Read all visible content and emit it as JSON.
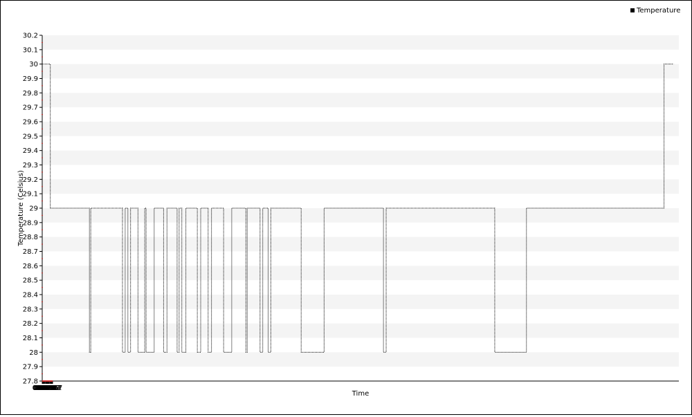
{
  "chart_data": {
    "type": "line",
    "step": true,
    "xlabel": "Time",
    "ylabel": "Temperature (Celsius)",
    "legend": {
      "position": "top-right"
    },
    "grid": "alternating horizontal bands",
    "colors": {
      "series": "#000000",
      "axis": "#000000",
      "tick_mark": "#d03030",
      "band": "#f4f4f4"
    },
    "x_ticks": [
      "00:00",
      "00:05",
      "00:10",
      "00:15",
      "00:20",
      "00:26",
      "00:31",
      "00:36",
      "00:41",
      "00:46",
      "00:51",
      "00:57",
      "01:02",
      "01:07",
      "01:12",
      "01:17"
    ],
    "xlim": [
      "00:00",
      "01:18:40"
    ],
    "ylim": [
      27.8,
      30.2
    ],
    "y_ticks": [
      "27.8",
      "27.9",
      "28",
      "28.1",
      "28.2",
      "28.3",
      "28.4",
      "28.5",
      "28.6",
      "28.7",
      "28.8",
      "28.9",
      "29",
      "29.1",
      "29.2",
      "29.3",
      "29.4",
      "29.5",
      "29.6",
      "29.7",
      "29.8",
      "29.9",
      "30",
      "30.1",
      "30.2"
    ],
    "series": [
      {
        "name": "Temperature",
        "points": [
          [
            "00:00:00",
            30
          ],
          [
            "00:01:00",
            29
          ],
          [
            "00:05:50",
            28
          ],
          [
            "00:06:00",
            29
          ],
          [
            "00:09:55",
            28
          ],
          [
            "00:10:15",
            29
          ],
          [
            "00:10:35",
            28
          ],
          [
            "00:10:55",
            29
          ],
          [
            "00:11:50",
            28
          ],
          [
            "00:12:40",
            29
          ],
          [
            "00:12:50",
            28
          ],
          [
            "00:13:50",
            29
          ],
          [
            "00:15:00",
            28
          ],
          [
            "00:15:25",
            29
          ],
          [
            "00:16:40",
            28
          ],
          [
            "00:16:55",
            29
          ],
          [
            "00:17:15",
            28
          ],
          [
            "00:17:45",
            29
          ],
          [
            "00:19:10",
            28
          ],
          [
            "00:19:35",
            29
          ],
          [
            "00:20:30",
            28
          ],
          [
            "00:20:55",
            29
          ],
          [
            "00:22:25",
            28
          ],
          [
            "00:23:25",
            29
          ],
          [
            "00:25:10",
            28
          ],
          [
            "00:25:20",
            29
          ],
          [
            "00:26:55",
            28
          ],
          [
            "00:27:15",
            29
          ],
          [
            "00:27:55",
            28
          ],
          [
            "00:28:15",
            29
          ],
          [
            "00:32:00",
            28
          ],
          [
            "00:34:50",
            29
          ],
          [
            "00:42:10",
            28
          ],
          [
            "00:42:30",
            29
          ],
          [
            "00:55:55",
            28
          ],
          [
            "00:59:50",
            29
          ],
          [
            "01:16:50",
            30
          ],
          [
            "01:18:00",
            30
          ]
        ]
      }
    ]
  }
}
